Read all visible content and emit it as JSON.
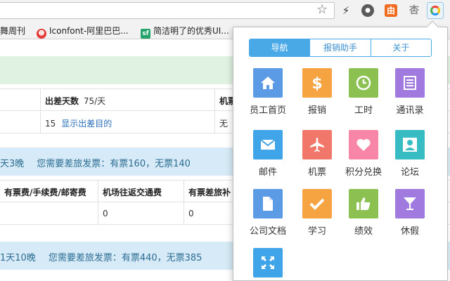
{
  "bookmarks": [
    {
      "label": "舞周刊",
      "icon": ""
    },
    {
      "label": "Iconfont-阿里巴巴...",
      "icon": "alien-icon"
    },
    {
      "label": "简洁明了的优秀UI...",
      "icon": "sf-icon",
      "icon_text": "sf"
    }
  ],
  "extensions": {
    "orange_text": "由",
    "grey_text": "杏"
  },
  "page": {
    "table1": {
      "headers": [
        "出差天数",
        "机票"
      ],
      "days_unit": "75/天",
      "row": [
        "15",
        "显示出差目的",
        "无"
      ]
    },
    "band1": [
      "天3晚",
      "您需要差旅发票：有票160，无票140"
    ],
    "table2": {
      "headers": [
        "有票费/手续费/邮寄费",
        "机场往返交通费",
        "有票差旅补"
      ],
      "row": [
        "",
        "0",
        "0"
      ]
    },
    "band2": [
      "1天10晚",
      "您需要差旅发票：有票440，无票385"
    ]
  },
  "popup": {
    "tabs": [
      {
        "label": "导航",
        "active": true
      },
      {
        "label": "报销助手",
        "active": false
      },
      {
        "label": "关于",
        "active": false
      }
    ],
    "tiles": [
      {
        "label": "员工首页",
        "icon": "home-icon",
        "color": "#5b9be6"
      },
      {
        "label": "报销",
        "icon": "dollar-icon",
        "color": "#f6a441"
      },
      {
        "label": "工时",
        "icon": "clock-icon",
        "color": "#8cc152"
      },
      {
        "label": "通讯录",
        "icon": "list-icon",
        "color": "#a17ae0"
      },
      {
        "label": "邮件",
        "icon": "mail-icon",
        "color": "#40a5e8"
      },
      {
        "label": "机票",
        "icon": "airplane-icon",
        "color": "#f2776b"
      },
      {
        "label": "积分兑换",
        "icon": "heart-icon",
        "color": "#f786a8"
      },
      {
        "label": "论坛",
        "icon": "user-icon",
        "color": "#37bcc4"
      },
      {
        "label": "公司文档",
        "icon": "document-icon",
        "color": "#5b9be6"
      },
      {
        "label": "学习",
        "icon": "check-icon",
        "color": "#f6a441"
      },
      {
        "label": "绩效",
        "icon": "thumbs-up-icon",
        "color": "#8cc152"
      },
      {
        "label": "休假",
        "icon": "cocktail-icon",
        "color": "#a17ae0"
      },
      {
        "label": "",
        "icon": "expand-icon",
        "color": "#40a5e8"
      }
    ]
  }
}
